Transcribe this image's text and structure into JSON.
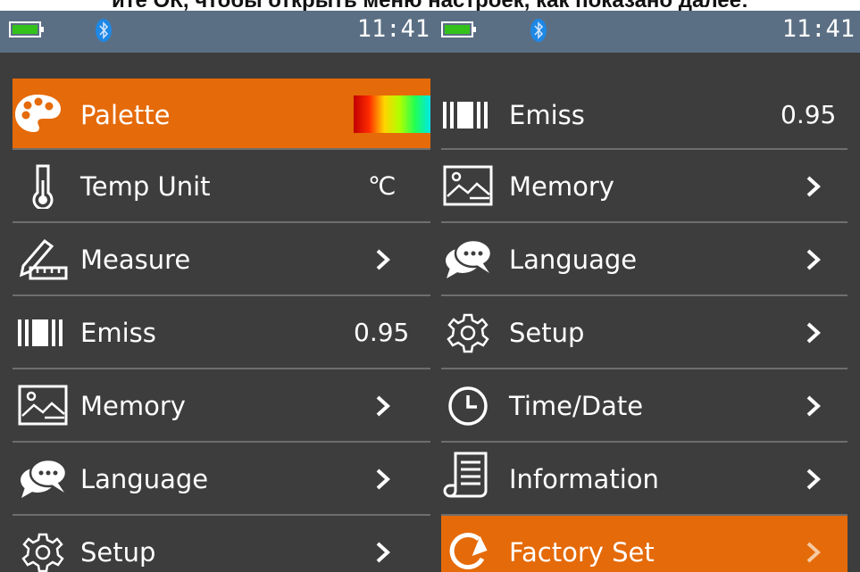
{
  "caption": "ите ОК, чтобы открыть меню настроек, как показано далее:",
  "status_bar": {
    "time": "11:41",
    "battery_color": "#34c21a",
    "bluetooth_color": "#1e88e5"
  },
  "colors": {
    "background": "#3d3d3d",
    "status_bar": "#5b6f84",
    "selected": "#e56a09",
    "text": "#ffffff"
  },
  "left_screen": {
    "items": [
      {
        "label": "Palette",
        "icon": "palette-icon",
        "value": "",
        "selected": true
      },
      {
        "label": "Temp Unit",
        "icon": "thermometer-icon",
        "value": "℃"
      },
      {
        "label": "Measure",
        "icon": "measure-ruler-icon",
        "value": ""
      },
      {
        "label": "Emiss",
        "icon": "emissivity-icon",
        "value": "0.95"
      },
      {
        "label": "Memory",
        "icon": "memory-image-icon",
        "value": ""
      },
      {
        "label": "Language",
        "icon": "language-chat-icon",
        "value": ""
      },
      {
        "label": "Setup",
        "icon": "gear-icon",
        "value": ""
      }
    ]
  },
  "right_screen": {
    "items": [
      {
        "label": "Emiss",
        "icon": "emissivity-icon",
        "value": "0.95"
      },
      {
        "label": "Memory",
        "icon": "memory-image-icon",
        "value": ""
      },
      {
        "label": "Language",
        "icon": "language-chat-icon",
        "value": ""
      },
      {
        "label": "Setup",
        "icon": "gear-icon",
        "value": ""
      },
      {
        "label": "Time/Date",
        "icon": "clock-icon",
        "value": ""
      },
      {
        "label": "Information",
        "icon": "information-document-icon",
        "value": ""
      },
      {
        "label": "Factory Set",
        "icon": "factory-reset-icon",
        "value": "",
        "selected": true
      }
    ]
  }
}
